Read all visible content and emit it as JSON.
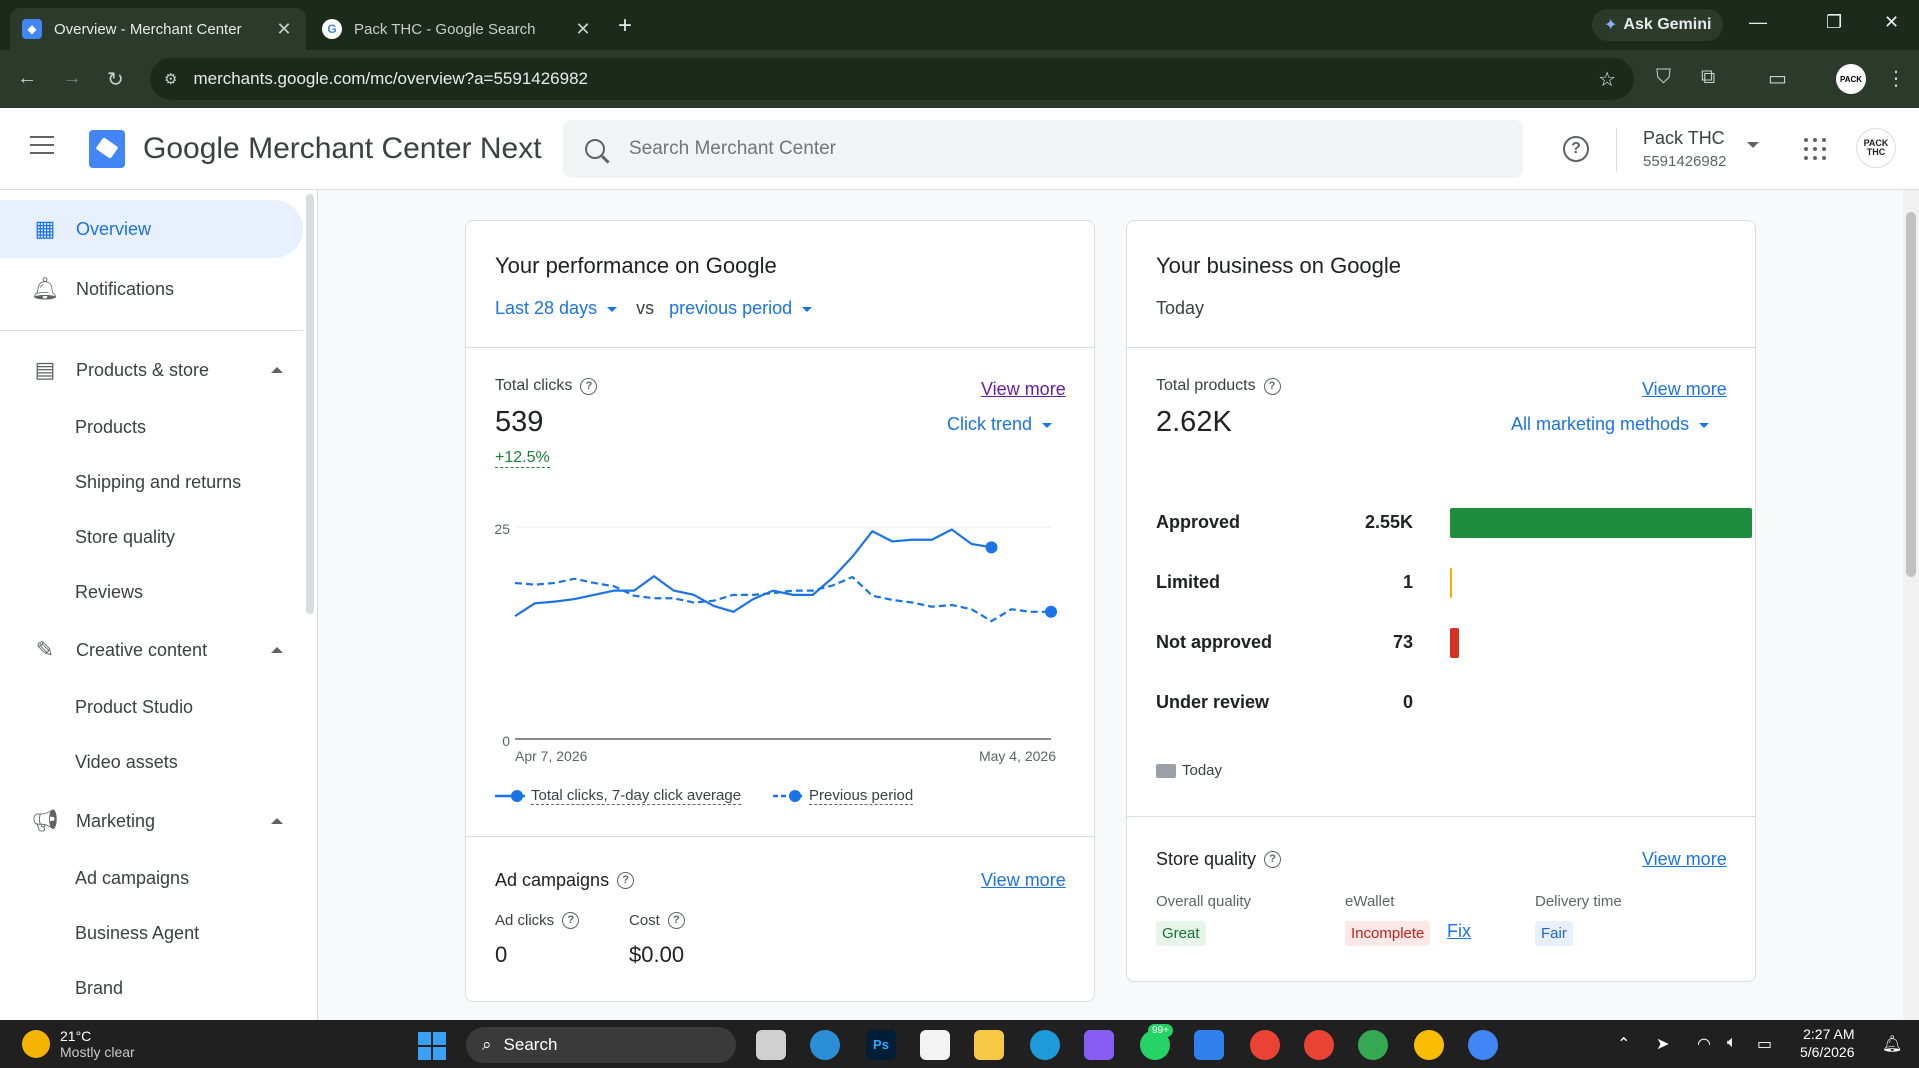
{
  "browser": {
    "tabs": [
      {
        "title": "Overview - Merchant Center",
        "active": true
      },
      {
        "title": "Pack THC - Google Search",
        "active": false
      }
    ],
    "gemini_label": "Ask Gemini",
    "url": "merchants.google.com/mc/overview?a=5591426982"
  },
  "header": {
    "app_name": "Google Merchant Center Next",
    "search_placeholder": "Search Merchant Center",
    "account_name": "Pack THC",
    "account_id": "5591426982",
    "avatar_text": "PACK THC"
  },
  "sidebar": {
    "items": [
      {
        "label": "Overview",
        "icon": "dashboard-icon",
        "active": true
      },
      {
        "label": "Notifications",
        "icon": "bell-icon"
      },
      {
        "label": "Products & store",
        "icon": "store-icon"
      },
      {
        "label": "Creative content",
        "icon": "wand-icon"
      },
      {
        "label": "Marketing",
        "icon": "megaphone-icon"
      }
    ],
    "products_store_sub": [
      "Products",
      "Shipping and returns",
      "Store quality",
      "Reviews"
    ],
    "creative_sub": [
      "Product Studio",
      "Video assets"
    ],
    "marketing_sub": [
      "Ad campaigns",
      "Business Agent",
      "Brand"
    ]
  },
  "performance": {
    "title": "Your performance on Google",
    "range": "Last 28 days",
    "vs": "vs",
    "compare": "previous period",
    "total_clicks_label": "Total clicks",
    "total_clicks": "539",
    "delta": "+12.5%",
    "view_more": "View more",
    "trend_label": "Click trend",
    "legend_current": "Total clicks, 7-day click average",
    "legend_previous": "Previous period",
    "ad_campaigns_label": "Ad campaigns",
    "ad_clicks_label": "Ad clicks",
    "ad_clicks": "0",
    "cost_label": "Cost",
    "cost": "$0.00"
  },
  "chart_data": {
    "type": "line",
    "x_start": "Apr 7, 2026",
    "x_end": "May 4, 2026",
    "x_tick_labels": [
      "Apr 7, 2026",
      "May 4, 2026"
    ],
    "ylim": [
      0,
      25
    ],
    "y_tick_labels": [
      "0",
      "25"
    ],
    "grid": true,
    "series": [
      {
        "name": "Total clicks, 7-day click average",
        "style": "solid",
        "color": "#1a73e8",
        "values": [
          14.5,
          16,
          16.2,
          16.5,
          17,
          17.5,
          17.5,
          19.2,
          17.5,
          17,
          15.7,
          15,
          16.5,
          17.5,
          17,
          17,
          19,
          21.5,
          24.5,
          23.3,
          23.5,
          23.5,
          24.7,
          23,
          22.6
        ]
      },
      {
        "name": "Previous period",
        "style": "dashed",
        "color": "#1a73e8",
        "values": [
          18.4,
          18.2,
          18.4,
          18.9,
          18.4,
          18,
          16.9,
          16.6,
          16.6,
          16.1,
          16.3,
          17,
          17,
          17.2,
          17.5,
          17.5,
          18.1,
          19.1,
          16.9,
          16.4,
          16.1,
          15.6,
          15.8,
          15.3,
          13.9,
          15.3,
          15,
          15
        ]
      }
    ]
  },
  "business": {
    "title": "Your business on Google",
    "subtitle": "Today",
    "total_products_label": "Total products",
    "total_products": "2.62K",
    "view_more": "View more",
    "methods_label": "All marketing methods",
    "statuses": [
      {
        "label": "Approved",
        "count": "2.55K",
        "value": 2550,
        "color": "#1e8e3e"
      },
      {
        "label": "Limited",
        "count": "1",
        "value": 1,
        "color": "#f9ab00"
      },
      {
        "label": "Not approved",
        "count": "73",
        "value": 73,
        "color": "#d93025"
      },
      {
        "label": "Under review",
        "count": "0",
        "value": 0,
        "color": "#9aa0a6"
      }
    ],
    "legend_today": "Today",
    "store_quality_label": "Store quality",
    "overall_label": "Overall quality",
    "overall_value": "Great",
    "wallet_label": "eWallet",
    "wallet_value": "Incomplete",
    "fix_label": "Fix",
    "delivery_label": "Delivery time",
    "delivery_value": "Fair"
  },
  "taskbar": {
    "temp": "21°C",
    "weather": "Mostly clear",
    "search_label": "Search",
    "time": "2:27 AM",
    "date": "5/6/2026",
    "badge": "99+"
  }
}
